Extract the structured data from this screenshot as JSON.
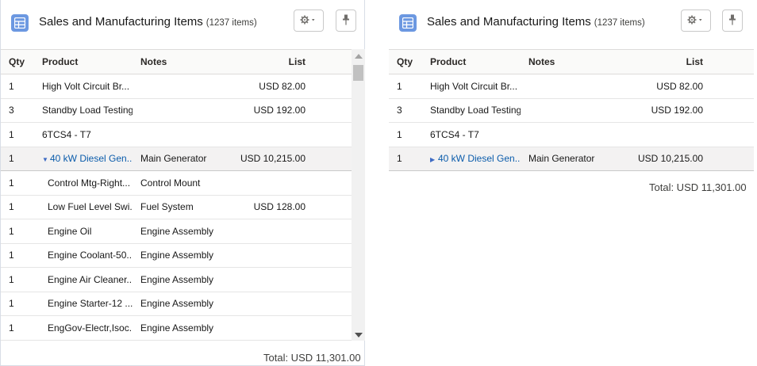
{
  "left": {
    "title": "Sales and Manufacturing Items",
    "count": "(1237 items)",
    "columns": {
      "qty": "Qty",
      "product": "Product",
      "notes": "Notes",
      "list": "List"
    },
    "rows": [
      {
        "qty": "1",
        "product": "High Volt Circuit Br...",
        "notes": "",
        "list": "USD 82.00"
      },
      {
        "qty": "3",
        "product": "Standby Load Testing",
        "notes": "",
        "list": "USD 192.00"
      },
      {
        "qty": "1",
        "product": "6TCS4 - T7",
        "notes": "",
        "list": ""
      },
      {
        "qty": "1",
        "product": "40 kW Diesel Gen...",
        "notes": "Main Generator",
        "list": "USD 10,215.00"
      },
      {
        "qty": "1",
        "product": "Control Mtg-Right...",
        "notes": "Control Mount",
        "list": ""
      },
      {
        "qty": "1",
        "product": "Low Fuel Level Swi...",
        "notes": "Fuel System",
        "list": "USD 128.00"
      },
      {
        "qty": "1",
        "product": "Engine Oil",
        "notes": "Engine Assembly",
        "list": ""
      },
      {
        "qty": "1",
        "product": "Engine Coolant-50...",
        "notes": "Engine Assembly",
        "list": ""
      },
      {
        "qty": "1",
        "product": "Engine Air Cleaner...",
        "notes": "Engine Assembly",
        "list": ""
      },
      {
        "qty": "1",
        "product": "Engine Starter-12 ...",
        "notes": "Engine Assembly",
        "list": ""
      },
      {
        "qty": "1",
        "product": "EngGov-Electr,Isoc...",
        "notes": "Engine Assembly",
        "list": ""
      }
    ],
    "total": "Total:  USD 11,301.00"
  },
  "right": {
    "title": "Sales and Manufacturing Items",
    "count": "(1237 items)",
    "columns": {
      "qty": "Qty",
      "product": "Product",
      "notes": "Notes",
      "list": "List"
    },
    "rows": [
      {
        "qty": "1",
        "product": "High Volt Circuit Br...",
        "notes": "",
        "list": "USD 82.00"
      },
      {
        "qty": "3",
        "product": "Standby Load Testing",
        "notes": "",
        "list": "USD 192.00"
      },
      {
        "qty": "1",
        "product": "6TCS4 - T7",
        "notes": "",
        "list": ""
      },
      {
        "qty": "1",
        "product": "40 kW Diesel Gen...",
        "notes": "Main Generator",
        "list": "USD 10,215.00"
      }
    ],
    "total": "Total:  USD 11,301.00"
  },
  "icons": {
    "app": "table-icon",
    "settings": "gear-icon",
    "pin": "pin-icon",
    "expanded": "chevron-down-icon",
    "collapsed": "chevron-right-icon"
  },
  "colors": {
    "accent": "#6c98e1",
    "link": "#0b5cab",
    "highlight_row": "#f3f2f2"
  }
}
